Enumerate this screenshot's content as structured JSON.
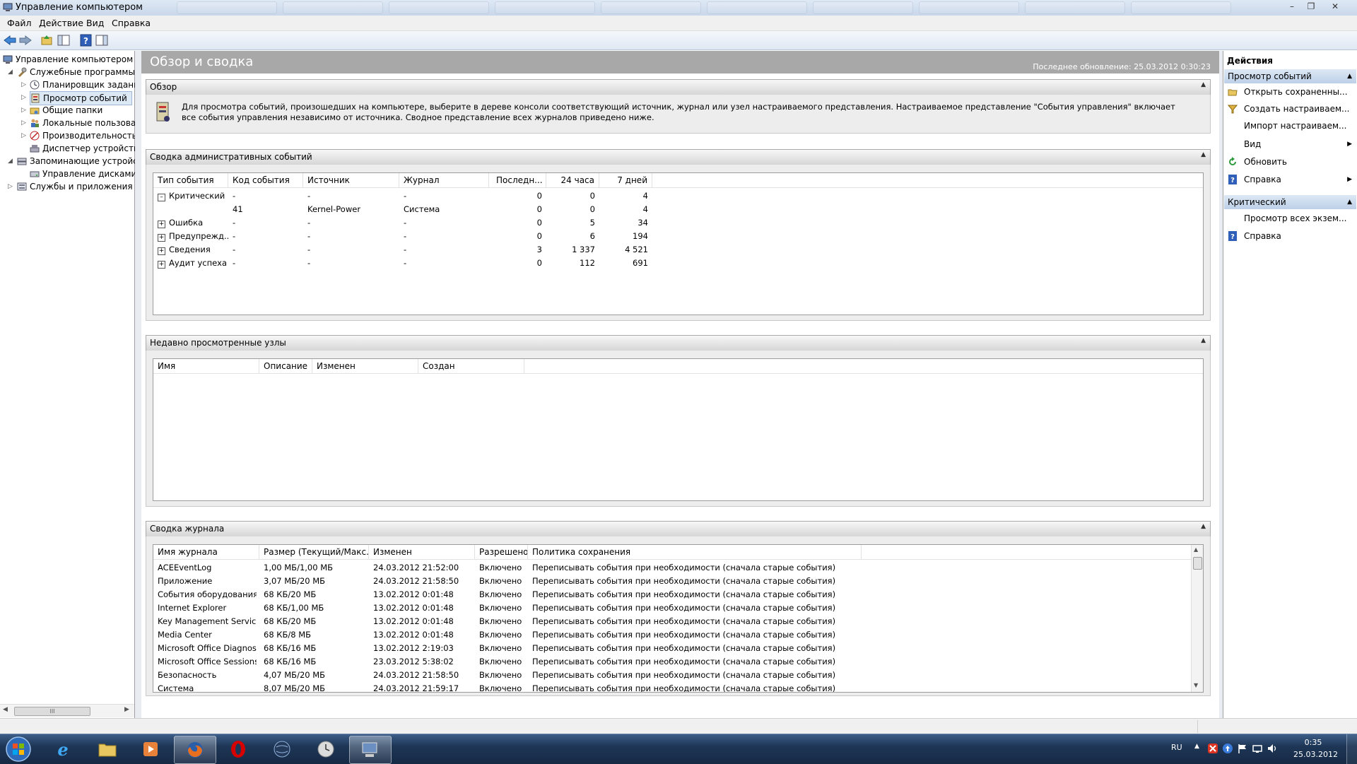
{
  "window": {
    "title": "Управление компьютером"
  },
  "menu": [
    "Файл",
    "Действие",
    "Вид",
    "Справка"
  ],
  "tree": {
    "root": "Управление компьютером (л",
    "items": [
      {
        "label": "Служебные программы",
        "level": 1,
        "expanded": true
      },
      {
        "label": "Планировщик заданий",
        "level": 2
      },
      {
        "label": "Просмотр событий",
        "level": 2,
        "selected": true
      },
      {
        "label": "Общие папки",
        "level": 2
      },
      {
        "label": "Локальные пользовате",
        "level": 2
      },
      {
        "label": "Производительность",
        "level": 2
      },
      {
        "label": "Диспетчер устройств",
        "level": 2
      },
      {
        "label": "Запоминающие устройст",
        "level": 1,
        "expanded": true
      },
      {
        "label": "Управление дисками",
        "level": 2
      },
      {
        "label": "Службы и приложения",
        "level": 1
      }
    ],
    "scroll_thumb": "III"
  },
  "center": {
    "title": "Обзор и сводка",
    "last_update": "Последнее обновление: 25.03.2012 0:30:23",
    "overview": {
      "header": "Обзор",
      "text": "Для просмотра событий, произошедших на компьютере, выберите в дереве консоли соответствующий источник, журнал или узел настраиваемого представления. Настраиваемое представление \"События управления\" включает все события управления независимо от источника. Сводное представление всех журналов приведено ниже."
    },
    "admin_summary": {
      "header": "Сводка административных событий",
      "columns": [
        "Тип события",
        "Код события",
        "Источник",
        "Журнал",
        "Последн...",
        "24 часа",
        "7 дней"
      ],
      "rows": [
        {
          "type": "Критический",
          "code": "-",
          "source": "-",
          "log": "-",
          "last": "0",
          "day": "0",
          "week": "4",
          "expander": "⊟"
        },
        {
          "type": "",
          "code": "41",
          "source": "Kernel-Power",
          "log": "Система",
          "last": "0",
          "day": "0",
          "week": "4",
          "expander": ""
        },
        {
          "type": "Ошибка",
          "code": "-",
          "source": "-",
          "log": "-",
          "last": "0",
          "day": "5",
          "week": "34",
          "expander": "⊞"
        },
        {
          "type": "Предупрежд...",
          "code": "-",
          "source": "-",
          "log": "-",
          "last": "0",
          "day": "6",
          "week": "194",
          "expander": "⊞"
        },
        {
          "type": "Сведения",
          "code": "-",
          "source": "-",
          "log": "-",
          "last": "3",
          "day": "1 337",
          "week": "4 521",
          "expander": "⊞"
        },
        {
          "type": "Аудит успеха",
          "code": "-",
          "source": "-",
          "log": "-",
          "last": "0",
          "day": "112",
          "week": "691",
          "expander": "⊞"
        }
      ]
    },
    "recent": {
      "header": "Недавно просмотренные узлы",
      "columns": [
        "Имя",
        "Описание",
        "Изменен",
        "Создан"
      ]
    },
    "log_summary": {
      "header": "Сводка журнала",
      "columns": [
        "Имя журнала",
        "Размер (Текущий/Макс.)",
        "Изменен",
        "Разрешено",
        "Политика сохранения"
      ],
      "rows": [
        {
          "name": "ACEEventLog",
          "size": "1,00 МБ/1,00 МБ",
          "modified": "24.03.2012 21:52:00",
          "enabled": "Включено",
          "policy": "Переписывать события при необходимости (сначала старые события)"
        },
        {
          "name": "Приложение",
          "size": "3,07 МБ/20 МБ",
          "modified": "24.03.2012 21:58:50",
          "enabled": "Включено",
          "policy": "Переписывать события при необходимости (сначала старые события)"
        },
        {
          "name": "События оборудования",
          "size": "68 КБ/20 МБ",
          "modified": "13.02.2012 0:01:48",
          "enabled": "Включено",
          "policy": "Переписывать события при необходимости (сначала старые события)"
        },
        {
          "name": "Internet Explorer",
          "size": "68 КБ/1,00 МБ",
          "modified": "13.02.2012 0:01:48",
          "enabled": "Включено",
          "policy": "Переписывать события при необходимости (сначала старые события)"
        },
        {
          "name": "Key Management Service",
          "size": "68 КБ/20 МБ",
          "modified": "13.02.2012 0:01:48",
          "enabled": "Включено",
          "policy": "Переписывать события при необходимости (сначала старые события)"
        },
        {
          "name": "Media Center",
          "size": "68 КБ/8 МБ",
          "modified": "13.02.2012 0:01:48",
          "enabled": "Включено",
          "policy": "Переписывать события при необходимости (сначала старые события)"
        },
        {
          "name": "Microsoft Office Diagnos...",
          "size": "68 КБ/16 МБ",
          "modified": "13.02.2012 2:19:03",
          "enabled": "Включено",
          "policy": "Переписывать события при необходимости (сначала старые события)"
        },
        {
          "name": "Microsoft Office Sessions",
          "size": "68 КБ/16 МБ",
          "modified": "23.03.2012 5:38:02",
          "enabled": "Включено",
          "policy": "Переписывать события при необходимости (сначала старые события)"
        },
        {
          "name": "Безопасность",
          "size": "4,07 МБ/20 МБ",
          "modified": "24.03.2012 21:58:50",
          "enabled": "Включено",
          "policy": "Переписывать события при необходимости (сначала старые события)"
        },
        {
          "name": "Система",
          "size": "8,07 МБ/20 МБ",
          "modified": "24.03.2012 21:59:17",
          "enabled": "Включено",
          "policy": "Переписывать события при необходимости (сначала старые события)"
        }
      ]
    }
  },
  "actions": {
    "header": "Действия",
    "groups": [
      {
        "title": "Просмотр событий",
        "items": [
          {
            "label": "Открыть сохраненны...",
            "icon": "folder-open-icon"
          },
          {
            "label": "Создать настраиваем...",
            "icon": "filter-icon"
          },
          {
            "label": "Импорт настраиваем...",
            "icon": ""
          },
          {
            "label": "Вид",
            "icon": "",
            "submenu": true
          },
          {
            "label": "Обновить",
            "icon": "refresh-icon"
          },
          {
            "label": "Справка",
            "icon": "help-icon",
            "submenu": true
          }
        ]
      },
      {
        "title": "Критический",
        "items": [
          {
            "label": "Просмотр всех экзем...",
            "icon": ""
          },
          {
            "label": "Справка",
            "icon": "help-icon"
          }
        ]
      }
    ]
  },
  "taskbar": {
    "language": "RU",
    "time": "0:35",
    "date": "25.03.2012"
  },
  "colors": {
    "center_header": "#a8a8a8",
    "action_group": "#c6d7ec",
    "taskbar": "#1e3656"
  }
}
